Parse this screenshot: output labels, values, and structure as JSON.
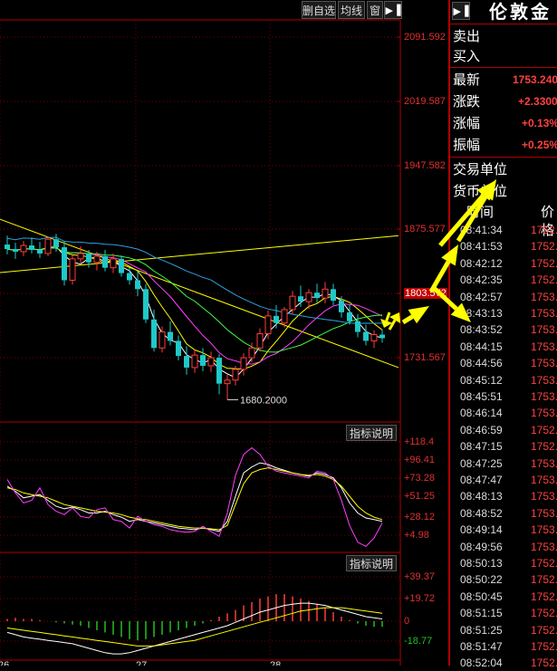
{
  "toolbar": {
    "watchlist": "删自选",
    "ma_lines": "均线",
    "window": "窗",
    "collapse_icon": "triangle-right"
  },
  "chart_data": {
    "type": "candlestick",
    "price_axis": {
      "range": [
        1660,
        2110
      ],
      "ticks": [
        "2091.592",
        "2019.587",
        "1947.582",
        "1875.577",
        "1803.572",
        "1731.567"
      ]
    },
    "highlight_price": "1803.572",
    "low_annotation": "1680.2000",
    "time_axis_labels": [
      "26",
      "27",
      "28"
    ],
    "colors": {
      "up": "#ff3c3c",
      "down": "#20c8c8",
      "ma_white": "#ffffff",
      "ma_yellow": "#ffff00",
      "ma_magenta": "#ff40ff",
      "ma_green": "#40ff40",
      "ma_blue": "#30a0e0",
      "trendline": "#ffff00",
      "arrows": "#ffff00"
    },
    "candles": [
      [
        1858,
        1868,
        1847,
        1853
      ],
      [
        1853,
        1860,
        1842,
        1850
      ],
      [
        1850,
        1862,
        1845,
        1857
      ],
      [
        1857,
        1866,
        1848,
        1852
      ],
      [
        1852,
        1861,
        1843,
        1848
      ],
      [
        1848,
        1867,
        1845,
        1864
      ],
      [
        1864,
        1870,
        1850,
        1855
      ],
      [
        1855,
        1862,
        1812,
        1818
      ],
      [
        1818,
        1846,
        1813,
        1842
      ],
      [
        1842,
        1856,
        1836,
        1848
      ],
      [
        1848,
        1852,
        1832,
        1838
      ],
      [
        1838,
        1850,
        1829,
        1845
      ],
      [
        1845,
        1852,
        1828,
        1832
      ],
      [
        1832,
        1848,
        1826,
        1842
      ],
      [
        1842,
        1846,
        1822,
        1826
      ],
      [
        1826,
        1832,
        1813,
        1818
      ],
      [
        1818,
        1828,
        1800,
        1808
      ],
      [
        1808,
        1814,
        1770,
        1774
      ],
      [
        1774,
        1785,
        1738,
        1742
      ],
      [
        1742,
        1766,
        1737,
        1760
      ],
      [
        1760,
        1772,
        1745,
        1750
      ],
      [
        1750,
        1756,
        1728,
        1733
      ],
      [
        1733,
        1744,
        1712,
        1720
      ],
      [
        1720,
        1740,
        1714,
        1734
      ],
      [
        1734,
        1742,
        1716,
        1722
      ],
      [
        1722,
        1738,
        1715,
        1731
      ],
      [
        1731,
        1735,
        1690,
        1702
      ],
      [
        1702,
        1712,
        1684,
        1706
      ],
      [
        1706,
        1722,
        1700,
        1718
      ],
      [
        1718,
        1736,
        1711,
        1731
      ],
      [
        1731,
        1748,
        1726,
        1742
      ],
      [
        1742,
        1764,
        1738,
        1758
      ],
      [
        1758,
        1784,
        1752,
        1778
      ],
      [
        1778,
        1790,
        1764,
        1770
      ],
      [
        1770,
        1788,
        1765,
        1785
      ],
      [
        1785,
        1806,
        1780,
        1800
      ],
      [
        1800,
        1812,
        1788,
        1794
      ],
      [
        1794,
        1808,
        1786,
        1804
      ],
      [
        1804,
        1814,
        1793,
        1798
      ],
      [
        1798,
        1816,
        1792,
        1808
      ],
      [
        1808,
        1814,
        1790,
        1795
      ],
      [
        1795,
        1800,
        1776,
        1782
      ],
      [
        1782,
        1791,
        1768,
        1772
      ],
      [
        1772,
        1780,
        1754,
        1760
      ],
      [
        1760,
        1768,
        1745,
        1750
      ],
      [
        1750,
        1762,
        1742,
        1757
      ],
      [
        1757,
        1763,
        1748,
        1753
      ]
    ],
    "trendlines": [
      {
        "from": [
          -4,
          1824
        ],
        "to": [
          48,
          1868
        ]
      },
      {
        "from": [
          -4,
          1897
        ],
        "to": [
          48,
          1720
        ]
      }
    ],
    "annotation_arrows": [
      "lower-left",
      "upper-right",
      "lower-right",
      "upper-right",
      "left"
    ],
    "indicator1": {
      "ticks": [
        "+118.4",
        "+96.41",
        "+73.28",
        "+51.25",
        "+28.12",
        "+4.98"
      ],
      "range": [
        -5,
        125
      ],
      "series": [
        {
          "name": "white",
          "color": "#ffffff",
          "values": [
            72,
            66,
            58,
            60,
            62,
            55,
            48,
            45,
            47,
            44,
            40,
            40,
            42,
            38,
            35,
            30,
            32,
            30,
            28,
            26,
            24,
            22,
            21,
            20,
            22,
            20,
            18,
            30,
            60,
            88,
            95,
            100,
            98,
            94,
            91,
            88,
            86,
            84,
            88,
            86,
            82,
            70,
            52,
            40,
            34,
            32,
            30
          ]
        },
        {
          "name": "yellow",
          "color": "#ffff00",
          "values": [
            70,
            68,
            64,
            62,
            60,
            58,
            54,
            50,
            48,
            46,
            44,
            42,
            41,
            40,
            38,
            35,
            33,
            32,
            30,
            28,
            26,
            24,
            23,
            22,
            22,
            21,
            20,
            25,
            50,
            75,
            88,
            92,
            94,
            92,
            90,
            88,
            86,
            85,
            86,
            84,
            80,
            72,
            60,
            48,
            40,
            35,
            32
          ]
        },
        {
          "name": "magenta",
          "color": "#ff40ff",
          "values": [
            80,
            64,
            52,
            55,
            70,
            50,
            42,
            38,
            46,
            36,
            34,
            44,
            46,
            32,
            30,
            22,
            36,
            30,
            26,
            24,
            20,
            18,
            17,
            18,
            24,
            18,
            12,
            40,
            85,
            110,
            118,
            110,
            96,
            90,
            88,
            86,
            84,
            82,
            90,
            88,
            80,
            55,
            25,
            5,
            0,
            10,
            28
          ]
        }
      ]
    },
    "indicator2": {
      "ticks": [
        "+39.37",
        "+19.72",
        "0",
        "-18.77"
      ],
      "range": [
        -30,
        45
      ],
      "histogram": [
        2,
        3,
        2,
        2,
        1,
        0,
        -1,
        -2,
        -3,
        -4,
        -6,
        -8,
        -10,
        -12,
        -14,
        -16,
        -17,
        -16,
        -14,
        -12,
        -10,
        -8,
        -6,
        -4,
        -2,
        1,
        4,
        7,
        10,
        14,
        17,
        20,
        22,
        24,
        24,
        22,
        20,
        18,
        15,
        12,
        8,
        4,
        1,
        -2,
        -4,
        -5,
        -5
      ],
      "series": [
        {
          "name": "white",
          "color": "#ffffff",
          "values": [
            -10,
            -12,
            -14,
            -15,
            -16,
            -17,
            -18,
            -19,
            -20,
            -22,
            -24,
            -26,
            -28,
            -29,
            -29,
            -28,
            -26,
            -24,
            -22,
            -20,
            -18,
            -16,
            -14,
            -12,
            -10,
            -8,
            -6,
            -4,
            -1,
            2,
            5,
            8,
            10,
            12,
            14,
            15,
            16,
            16,
            15,
            14,
            12,
            10,
            8,
            6,
            4,
            3,
            2
          ]
        },
        {
          "name": "yellow",
          "color": "#ffff00",
          "values": [
            -6,
            -7,
            -8,
            -9,
            -10,
            -11,
            -12,
            -13,
            -14,
            -15,
            -16,
            -17,
            -18,
            -19,
            -20,
            -21,
            -22,
            -22,
            -22,
            -21,
            -20,
            -19,
            -18,
            -17,
            -15,
            -13,
            -11,
            -9,
            -7,
            -5,
            -3,
            -1,
            1,
            3,
            5,
            7,
            9,
            10,
            11,
            12,
            12,
            12,
            11,
            10,
            9,
            8,
            7
          ]
        }
      ]
    }
  },
  "indicator_buttons": {
    "upper": "指标说明",
    "lower": "指标说明"
  },
  "quote": {
    "header_icon": "triangle-right",
    "title": "伦敦金 |",
    "sell": "卖出",
    "buy": "买入",
    "latest_label": "最新",
    "latest_value": "1753.2400",
    "change_label": "涨跌",
    "change_value": "+2.3300",
    "pct_label": "涨幅",
    "pct_value": "+0.13%",
    "amp_label": "振幅",
    "amp_value": "+0.25%",
    "trade_unit_label": "交易单位",
    "currency_unit_label": "货币单位"
  },
  "ticks": {
    "headers": [
      "时间",
      "价格"
    ],
    "rows": [
      {
        "time": "08:41:34",
        "price": "1752."
      },
      {
        "time": "08:41:53",
        "price": "1752."
      },
      {
        "time": "08:42:12",
        "price": "1752."
      },
      {
        "time": "08:42:35",
        "price": "1752."
      },
      {
        "time": "08:42:57",
        "price": "1753."
      },
      {
        "time": "08:43:13",
        "price": "1753."
      },
      {
        "time": "08:43:52",
        "price": "1753."
      },
      {
        "time": "08:44:15",
        "price": "1753."
      },
      {
        "time": "08:44:56",
        "price": "1753."
      },
      {
        "time": "08:45:12",
        "price": "1753."
      },
      {
        "time": "08:45:51",
        "price": "1753."
      },
      {
        "time": "08:46:14",
        "price": "1753."
      },
      {
        "time": "08:46:59",
        "price": "1752."
      },
      {
        "time": "08:47:15",
        "price": "1752."
      },
      {
        "time": "08:47:25",
        "price": "1753."
      },
      {
        "time": "08:47:47",
        "price": "1753."
      },
      {
        "time": "08:48:13",
        "price": "1753."
      },
      {
        "time": "08:48:52",
        "price": "1753."
      },
      {
        "time": "08:49:14",
        "price": "1753."
      },
      {
        "time": "08:49:56",
        "price": "1753."
      },
      {
        "time": "08:50:13",
        "price": "1752."
      },
      {
        "time": "08:50:22",
        "price": "1752."
      },
      {
        "time": "08:50:45",
        "price": "1752."
      },
      {
        "time": "08:51:15",
        "price": "1752."
      },
      {
        "time": "08:51:25",
        "price": "1752."
      },
      {
        "time": "08:51:47",
        "price": "1752."
      },
      {
        "time": "08:52:04",
        "price": "1752."
      }
    ]
  }
}
